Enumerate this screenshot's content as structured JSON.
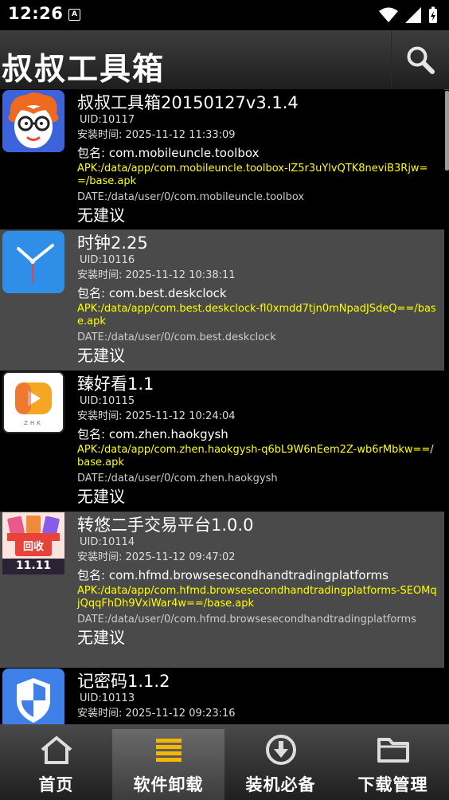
{
  "status": {
    "time": "12:26",
    "notif_letter": "A"
  },
  "header": {
    "title": "叔叔工具箱"
  },
  "apps": [
    {
      "name": "叔叔工具箱20150127v3.1.4",
      "uid": "UID:10117",
      "install": "安装时间:  2025-11-12 11:33:09",
      "pkg": "包名:  com.mobileuncle.toolbox",
      "apk": "APK:/data/app/com.mobileuncle.toolbox-lZ5r3uYlvQTK8neviB3Rjw==/base.apk",
      "date": "DATE:/data/user/0/com.mobileuncle.toolbox",
      "advice": "无建议",
      "icon": "mobileuncle-face-icon"
    },
    {
      "name": "时钟2.25",
      "uid": "UID:10116",
      "install": "安装时间:  2025-11-12 10:38:11",
      "pkg": "包名:  com.best.deskclock",
      "apk": "APK:/data/app/com.best.deskclock-fl0xmdd7tjn0mNpadJSdeQ==/base.apk",
      "date": "DATE:/data/user/0/com.best.deskclock",
      "advice": "无建议",
      "icon": "clock-icon"
    },
    {
      "name": "臻好看1.1",
      "uid": "UID:10115",
      "install": "安装时间:  2025-11-12 10:24:04",
      "pkg": "包名:  com.zhen.haokgysh",
      "apk": "APK:/data/app/com.zhen.haokgysh-q6bL9W6nEem2Z-wb6rMbkw==/base.apk",
      "date": "DATE:/data/user/0/com.zhen.haokgysh",
      "advice": "无建议",
      "icon": "play-icon",
      "icon_text": "ZHK"
    },
    {
      "name": "转悠二手交易平台1.0.0",
      "uid": "UID:10114",
      "install": "安装时间:  2025-11-12 09:47:02",
      "pkg": "包名:  com.hfmd.browsesecondhandtradingplatforms",
      "apk": "APK:/data/app/com.hfmd.browsesecondhandtradingplatforms-SEOMqjQqqFhDh9VxiWar4w==/base.apk",
      "date": "DATE:/data/user/0/com.hfmd.browsesecondhandtradingplatforms",
      "advice": "无建议",
      "icon": "recycle-icon",
      "icon_text": "回收",
      "icon_text2": "11.11"
    },
    {
      "name": "记密码1.1.2",
      "uid": "UID:10113",
      "install": "安装时间:  2025-11-12 09:23:16",
      "icon": "shield-icon"
    }
  ],
  "nav": [
    {
      "label": "首页",
      "icon": "home-icon"
    },
    {
      "label": "软件卸载",
      "icon": "list-icon",
      "active": true
    },
    {
      "label": "装机必备",
      "icon": "download-icon"
    },
    {
      "label": "下载管理",
      "icon": "folder-icon"
    }
  ],
  "colors": {
    "apk_text": "#ffff00",
    "row_alt": "#4a4a4a",
    "clock_bg": "#2f8fe8"
  }
}
